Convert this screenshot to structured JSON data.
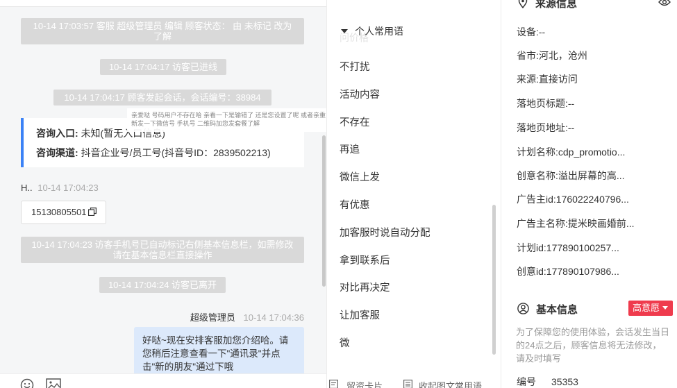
{
  "chat": {
    "system_messages": [
      "10-14 17:03:57 客服 超级管理员 编辑 顾客状态： 由 未标记 改为 了解",
      "10-14 17:04:17 访客已进线",
      "10-14 17:04:17 顾客发起会话，会话编号：38984",
      "10-14 17:04:23 访客手机号已自动标记右侧基本信息栏，如需修改请在基本信息栏直接操作",
      "10-14 17:04:24 访客已离开"
    ],
    "tooltip": "亲爱哒 号码用户不存在哈 亲看一下是输错了 还是您设置了呢 或者亲重新发一下微信号 手机号 二维码加您发套餐了解",
    "consult_card": {
      "entry_label": "咨询入口:",
      "entry_value": "未知(暂无入口信息)",
      "channel_label": "咨询渠道:",
      "channel_value": "抖音企业号/员工号(抖音号ID：2839502213)"
    },
    "visitor": {
      "name": "H..",
      "time": "10-14 17:04:23",
      "phone": "15130805501"
    },
    "agent": {
      "name": "超级管理员",
      "time": "10-14 17:04:36",
      "message": "好哒~现在安排客服加您介绍哈。请您稍后注意查看一下\"通讯录\"并点击\"新的朋友\"通过下哦"
    }
  },
  "quick_replies": {
    "header": "个人常用语",
    "partial_item": "问价格",
    "items": [
      "不打扰",
      "活动内容",
      "不存在",
      "再追",
      "微信上发",
      "有优惠",
      "加客服时说自动分配",
      "拿到联系后",
      "对比再决定",
      "让加客服",
      "微"
    ],
    "footer": {
      "card_label": "留资卡片",
      "collapse_label": "收起图文常用语"
    }
  },
  "source_info": {
    "title": "来源信息",
    "rows": [
      {
        "label": "设备:",
        "value": "--"
      },
      {
        "label": "省市:",
        "value": "河北，沧州"
      },
      {
        "label": "来源:",
        "value": "直接访问"
      },
      {
        "label": "落地页标题:",
        "value": "--"
      },
      {
        "label": "落地页地址:",
        "value": "--"
      },
      {
        "label": "计划名称:",
        "value": "cdp_promotio..."
      },
      {
        "label": "创意名称:",
        "value": "溢出屏幕的高..."
      },
      {
        "label": "广告主id:",
        "value": "176022240796..."
      },
      {
        "label": "广告主名称:",
        "value": "提米映画婚前..."
      },
      {
        "label": "计划id:",
        "value": "177890100257..."
      },
      {
        "label": "创意id:",
        "value": "177890107986..."
      }
    ]
  },
  "basic_info": {
    "title": "基本信息",
    "intent_badge": "高意愿",
    "note": "为了保障您的使用体验，会话发生当日的24点之后，顾客信息将无法修改，请及时填写",
    "serial_label": "编号",
    "serial_value": "35353"
  },
  "colors": {
    "accent_blue": "#3b82f6",
    "badge_red": "#ef3b4d",
    "agent_bubble": "#dce9fb",
    "system_bubble": "#d9d9d9"
  }
}
